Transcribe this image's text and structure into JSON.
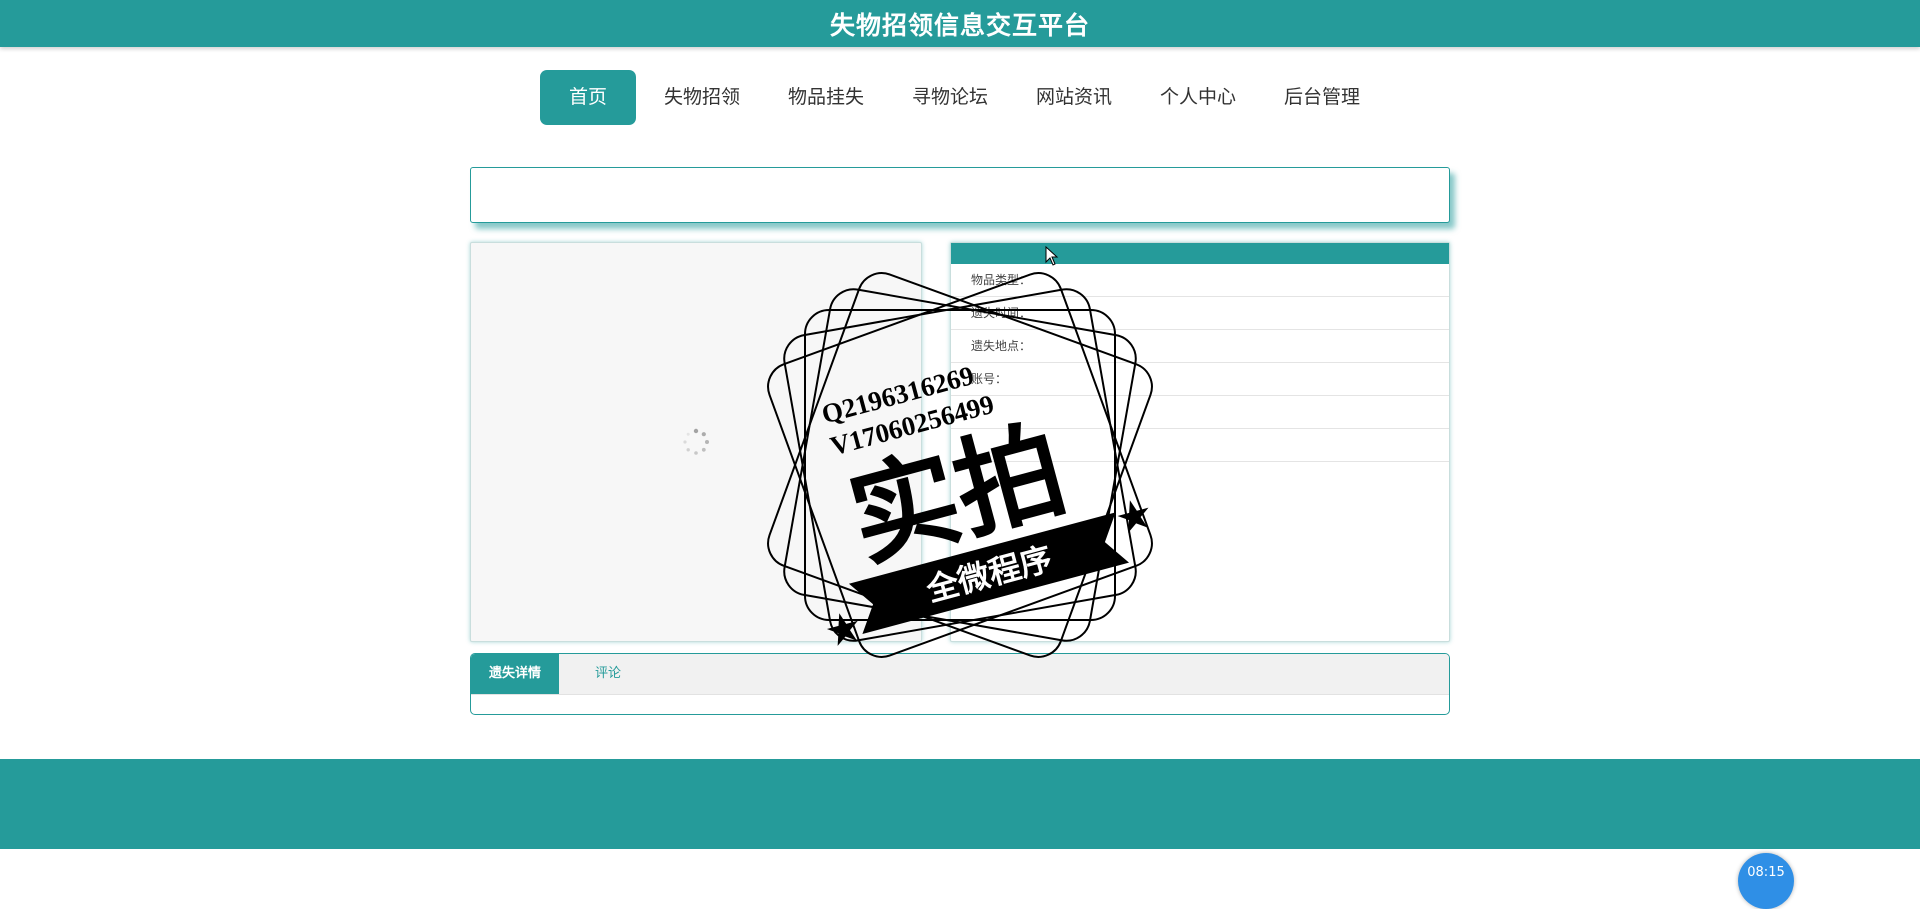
{
  "header": {
    "title": "失物招领信息交互平台"
  },
  "nav": {
    "items": [
      {
        "label": "首页"
      },
      {
        "label": "失物招领"
      },
      {
        "label": "物品挂失"
      },
      {
        "label": "寻物论坛"
      },
      {
        "label": "网站资讯"
      },
      {
        "label": "个人中心"
      },
      {
        "label": "后台管理"
      }
    ],
    "active": "首页"
  },
  "info": {
    "rows": [
      {
        "label": "物品类型："
      },
      {
        "label": "遗失时间："
      },
      {
        "label": "遗失地点："
      },
      {
        "label": "账号："
      },
      {
        "label": ""
      },
      {
        "label": ""
      }
    ]
  },
  "tabs": [
    {
      "label": "遗失详情"
    },
    {
      "label": "评论"
    }
  ],
  "watermark": {
    "line1": "Q2196316269",
    "line2": "V17060256499",
    "main": "实拍",
    "ribbon": "全微程序"
  },
  "clock": {
    "time": "08:15"
  },
  "colors": {
    "primary": "#259b9a",
    "clock": "#2f8fe6"
  }
}
